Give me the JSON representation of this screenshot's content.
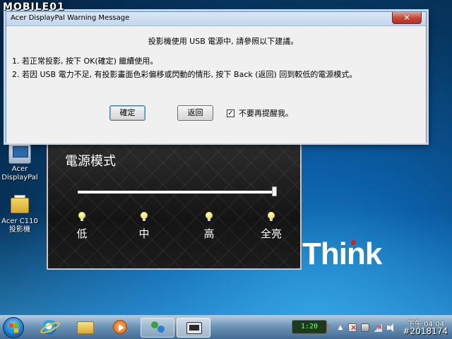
{
  "watermark": {
    "top": "MOBILE01",
    "bottom": "#2018174"
  },
  "desktop": {
    "brand": "Think",
    "icons": [
      {
        "label": "Acer DisplayPal"
      },
      {
        "label": "Acer C110 投影機"
      }
    ]
  },
  "dialog": {
    "title": "Acer DisplayPal Warning Message",
    "close_label": "×",
    "heading": "投影機使用 USB 電源中, 請參照以下建議。",
    "line1": "1. 若正常投影, 按下 OK(確定) 繼續使用。",
    "line2": "2. 若因 USB 電力不足, 有投影畫面色彩偏移或閃動的情形, 按下 Back (返回) 回到較低的電源模式。",
    "ok_label": "確定",
    "back_label": "返回",
    "checkbox_mark": "✓",
    "checkbox_label": "不要再提醒我。",
    "checkbox_checked": true
  },
  "power_panel": {
    "title": "電源模式",
    "slider_value": 1.0,
    "levels": [
      "低",
      "中",
      "高",
      "全亮"
    ],
    "selected_level": "全亮"
  },
  "taskbar": {
    "pinned": [
      "start-button",
      "internet-explorer-icon",
      "file-explorer-icon",
      "media-player-icon",
      "messenger-icon",
      "displaypal-icon"
    ],
    "battery_text": "1:20",
    "tray_arrow": "▲",
    "clock_time": "下午 04:04"
  }
}
